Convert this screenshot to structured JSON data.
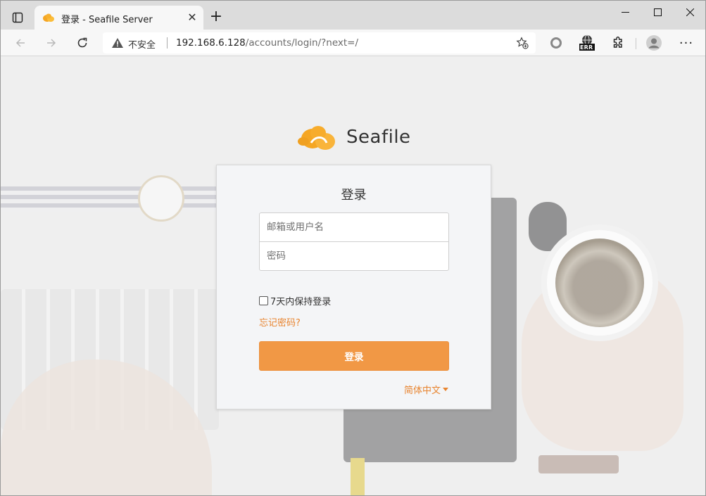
{
  "browser": {
    "tab": {
      "title": "登录 - Seafile Server",
      "close_label": "✕"
    },
    "new_tab_label": "+",
    "window_controls": {
      "minimize": "—",
      "maximize": "☐",
      "close": "✕"
    },
    "toolbar": {
      "back_icon": "arrow-left-icon",
      "forward_icon": "arrow-right-icon",
      "reload_icon": "reload-icon"
    },
    "address": {
      "security_label": "不安全",
      "url_host": "192.168.6.128",
      "url_path": "/accounts/login/?next=/"
    },
    "extensions": {
      "err_badge": "ERR",
      "more_label": "···"
    }
  },
  "page": {
    "logo_text_prefix": "S",
    "logo_text_middle": "ea",
    "logo_text_suffix": "file",
    "login": {
      "title": "登录",
      "username_placeholder": "邮箱或用户名",
      "password_placeholder": "密码",
      "remember_label": "7天内保持登录",
      "forgot_label": "忘记密码?",
      "submit_label": "登录",
      "language_label": "简体中文"
    }
  },
  "colors": {
    "accent": "#f19845",
    "link": "#e8842f",
    "logo_orange": "#f5a623"
  }
}
